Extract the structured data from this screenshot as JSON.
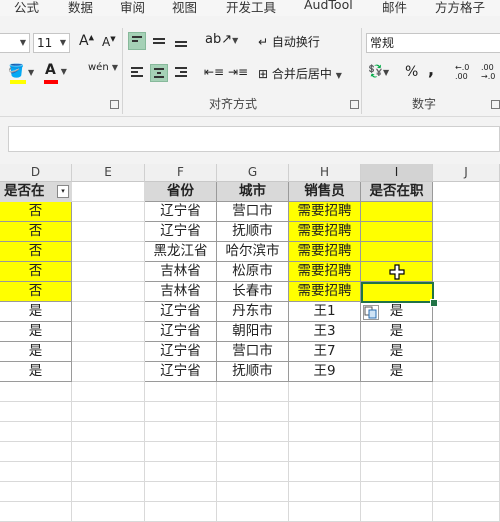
{
  "tabs": [
    "公式",
    "数据",
    "审阅",
    "视图",
    "开发工具",
    "AudTool",
    "邮件",
    "方方格子"
  ],
  "font": {
    "size": "11",
    "grow": "A",
    "shrink": "A",
    "fill_color": "#ffff00",
    "font_color": "#ff0000",
    "phonetic": "wén"
  },
  "alignment": {
    "wrap_text": "自动换行",
    "merge_center": "合并后居中",
    "group_label": "对齐方式"
  },
  "number": {
    "format": "常规",
    "percent": "%",
    "comma": ",",
    "inc_decimal": "←.0\n.00",
    "dec_decimal": ".00\n→.0",
    "group_label": "数字"
  },
  "columns": [
    "D",
    "E",
    "F",
    "G",
    "H",
    "I",
    "J"
  ],
  "left_table": {
    "header": "是否在",
    "values": [
      "否",
      "否",
      "否",
      "否",
      "否",
      "是",
      "是",
      "是",
      "是"
    ]
  },
  "right_table": {
    "headers": [
      "省份",
      "城市",
      "销售员",
      "是否在职"
    ],
    "rows": [
      [
        "辽宁省",
        "营口市",
        "需要招聘",
        ""
      ],
      [
        "辽宁省",
        "抚顺市",
        "需要招聘",
        ""
      ],
      [
        "黑龙江省",
        "哈尔滨市",
        "需要招聘",
        ""
      ],
      [
        "吉林省",
        "松原市",
        "需要招聘",
        ""
      ],
      [
        "吉林省",
        "长春市",
        "需要招聘",
        ""
      ],
      [
        "辽宁省",
        "丹东市",
        "王1",
        "是"
      ],
      [
        "辽宁省",
        "朝阳市",
        "王3",
        "是"
      ],
      [
        "辽宁省",
        "营口市",
        "王7",
        "是"
      ],
      [
        "辽宁省",
        "抚顺市",
        "王9",
        "是"
      ]
    ]
  },
  "colors": {
    "highlight": "#ffff00",
    "header_fill": "#d9d9d9",
    "selection": "#217346",
    "active_button": "#a5d1b6"
  }
}
